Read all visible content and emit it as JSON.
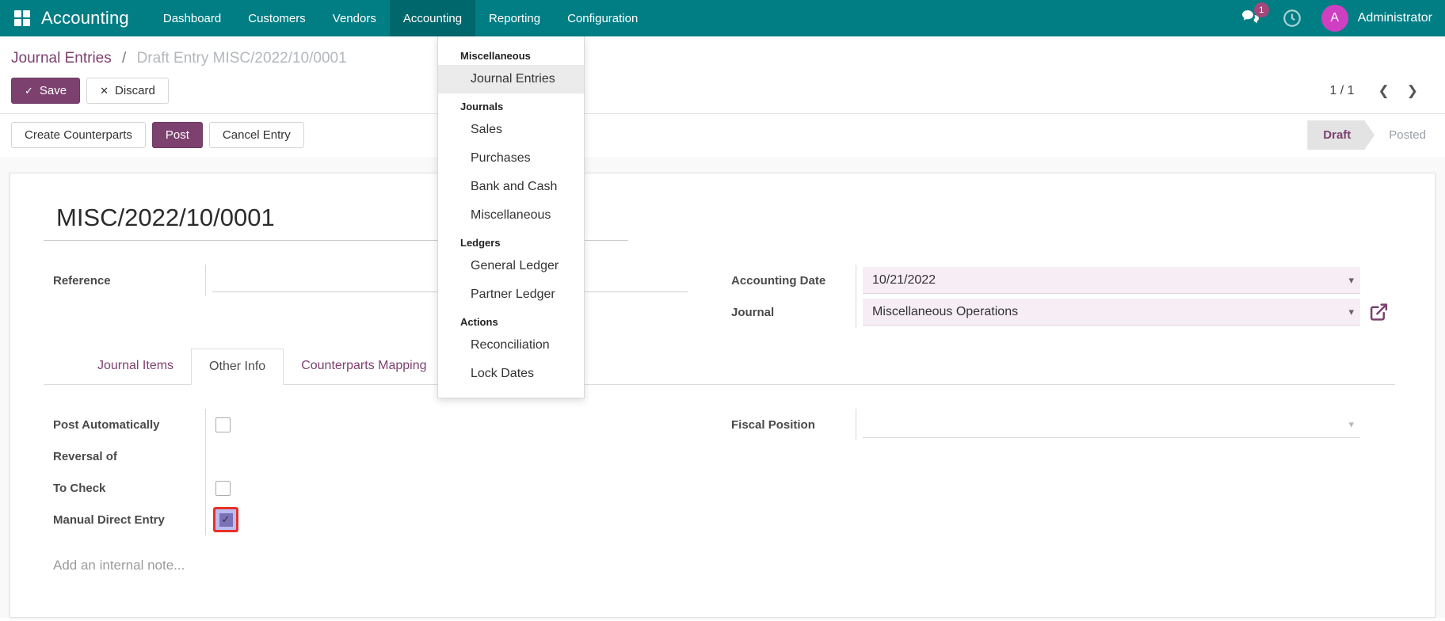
{
  "topbar": {
    "brand": "Accounting",
    "menus": [
      {
        "label": "Dashboard",
        "active": false
      },
      {
        "label": "Customers",
        "active": false
      },
      {
        "label": "Vendors",
        "active": false
      },
      {
        "label": "Accounting",
        "active": true
      },
      {
        "label": "Reporting",
        "active": false
      },
      {
        "label": "Configuration",
        "active": false
      }
    ],
    "messages_badge": "1",
    "avatar_initial": "A",
    "user_name": "Administrator"
  },
  "dropdown": {
    "sections": [
      {
        "heading": "Miscellaneous",
        "items": [
          {
            "label": "Journal Entries",
            "active": true
          }
        ]
      },
      {
        "heading": "Journals",
        "items": [
          {
            "label": "Sales"
          },
          {
            "label": "Purchases"
          },
          {
            "label": "Bank and Cash"
          },
          {
            "label": "Miscellaneous"
          }
        ]
      },
      {
        "heading": "Ledgers",
        "items": [
          {
            "label": "General Ledger"
          },
          {
            "label": "Partner Ledger"
          }
        ]
      },
      {
        "heading": "Actions",
        "items": [
          {
            "label": "Reconciliation"
          },
          {
            "label": "Lock Dates"
          }
        ]
      }
    ]
  },
  "breadcrumb": {
    "parent": "Journal Entries",
    "separator": "/",
    "current": "Draft Entry MISC/2022/10/0001"
  },
  "controls": {
    "save": "Save",
    "discard": "Discard",
    "pager": "1 / 1"
  },
  "actions": {
    "create_counterparts": "Create Counterparts",
    "post": "Post",
    "cancel_entry": "Cancel Entry",
    "statusbar": [
      {
        "label": "Draft",
        "active": true
      },
      {
        "label": "Posted",
        "active": false
      }
    ]
  },
  "form": {
    "title": "MISC/2022/10/0001",
    "fields": {
      "reference_label": "Reference",
      "accounting_date_label": "Accounting Date",
      "accounting_date_value": "10/21/2022",
      "journal_label": "Journal",
      "journal_value": "Miscellaneous Operations",
      "fiscal_position_label": "Fiscal Position",
      "post_automatically_label": "Post Automatically",
      "reversal_of_label": "Reversal of",
      "to_check_label": "To Check",
      "manual_direct_entry_label": "Manual Direct Entry"
    },
    "tabs": [
      {
        "label": "Journal Items",
        "active": false
      },
      {
        "label": "Other Info",
        "active": true
      },
      {
        "label": "Counterparts Mapping",
        "active": false
      }
    ],
    "checkboxes": {
      "post_automatically": false,
      "to_check": false,
      "manual_direct_entry": true
    },
    "note_placeholder": "Add an internal note..."
  },
  "icons": {
    "check": "✓",
    "close": "✕",
    "chevron_left": "❮",
    "chevron_right": "❯",
    "caret_down": "▾"
  },
  "colors": {
    "navbar_teal": "#017e84",
    "primary_purple": "#7d4170",
    "input_pink": "#f6edf5",
    "highlight_red": "#e8312a",
    "avatar_magenta": "#ce3fc2",
    "badge_plum": "#a3487b"
  }
}
